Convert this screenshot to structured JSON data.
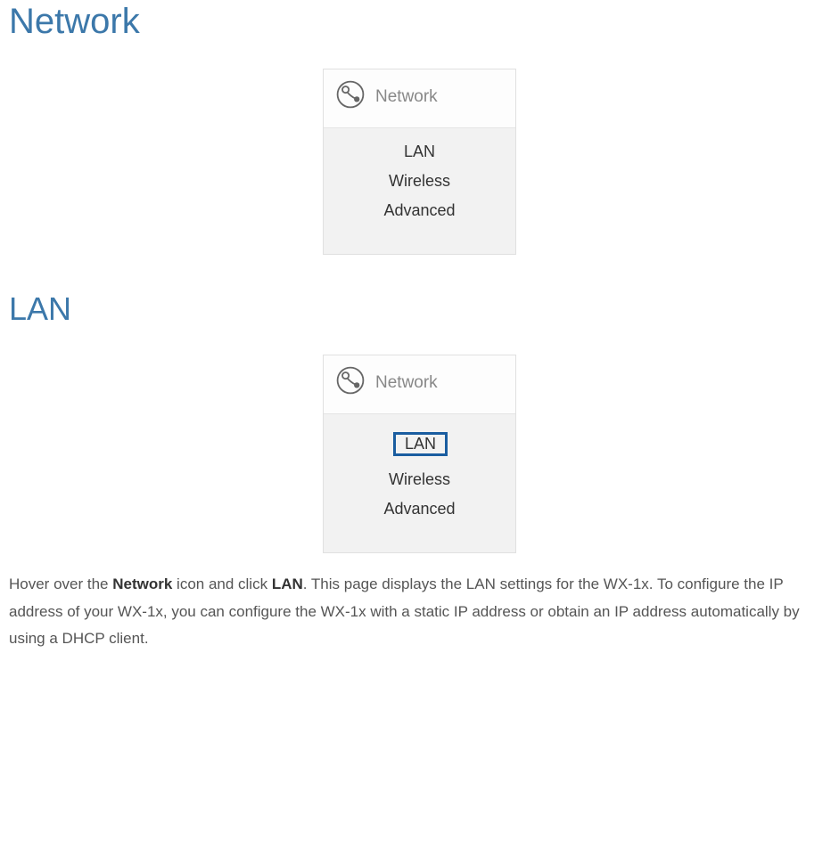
{
  "section1": {
    "title": "Network",
    "menu": {
      "headerLabel": "Network",
      "items": [
        "LAN",
        "Wireless",
        "Advanced"
      ]
    }
  },
  "section2": {
    "title": "LAN",
    "menu": {
      "headerLabel": "Network",
      "items": [
        "LAN",
        "Wireless",
        "Advanced"
      ]
    },
    "descPrefix": "Hover over the ",
    "descBold1": "Network",
    "descMid": " icon and click ",
    "descBold2": "LAN",
    "descSuffix": ". This page displays the LAN settings for the WX-1x. To configure the IP address of your WX-1x, you can configure the WX-1x with a static IP address or obtain an IP address automatically by using a DHCP client."
  }
}
